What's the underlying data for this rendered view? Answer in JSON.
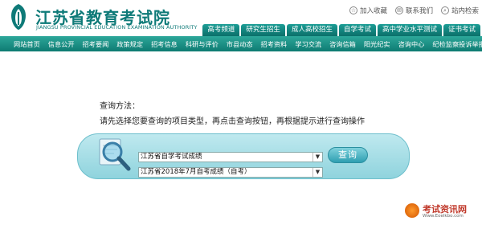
{
  "header": {
    "logo_cn": "江苏省教育考试院",
    "logo_en": "JIANGSU PROVINCIAL EDUCATION EXAMINATION AUTHORITY",
    "top_links": [
      {
        "label": "加入收藏",
        "icon": "star-icon"
      },
      {
        "label": "联系我们",
        "icon": "contact-icon"
      },
      {
        "label": "站内检索",
        "icon": "search-icon"
      }
    ],
    "tabs": [
      "高考频道",
      "研究生招生",
      "成人高校招生",
      "自学考试",
      "高中学业水平测试",
      "证书考试"
    ]
  },
  "nav": {
    "items": [
      "网站首页",
      "信息公开",
      "招考要闻",
      "政策规定",
      "招考信息",
      "科研与评价",
      "市县动态",
      "招考资料",
      "学习交流",
      "咨询信箱",
      "阳光纪实",
      "咨询中心",
      "纪检监察投诉举报"
    ]
  },
  "query": {
    "title": "查询方法：",
    "description": "请先选择您要查询的项目类型，再点击查询按钮，再根据提示进行查询操作",
    "select1": "江苏省自学考试成绩",
    "select2": "江苏省2018年7月自考成绩（自考）",
    "button_label": "查询"
  },
  "watermark": {
    "text": "考试资讯网",
    "url": "Www.Eoelkbo.com"
  },
  "colors": {
    "brand": "#0e7a78",
    "nav_bg": "#1a8d83",
    "query_box": "#a9dfe7"
  }
}
